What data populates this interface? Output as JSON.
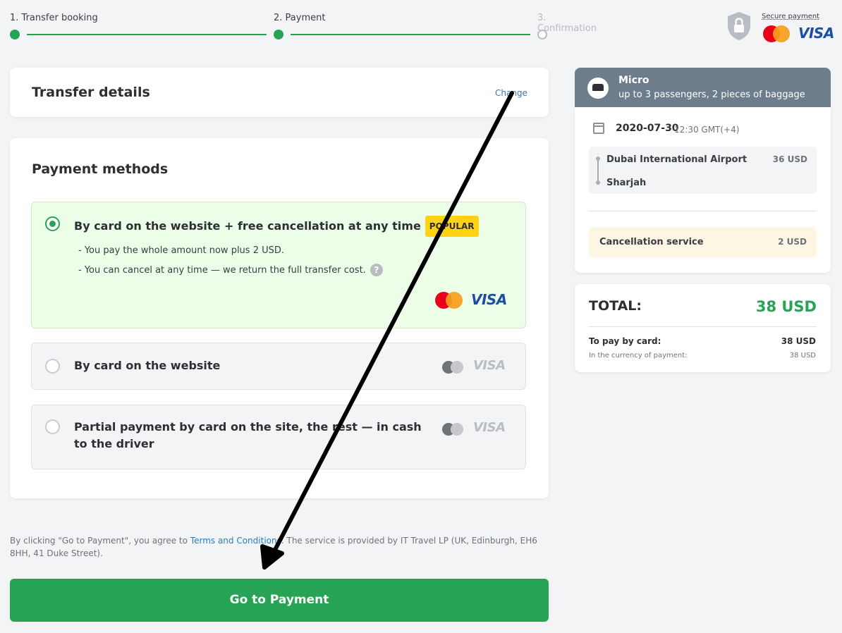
{
  "stepper": {
    "steps": [
      {
        "label": "1. Transfer booking",
        "state": "done"
      },
      {
        "label": "2. Payment",
        "state": "current"
      },
      {
        "label": "3. Confirmation",
        "state": "pending"
      }
    ]
  },
  "secure": {
    "label": "Secure payment",
    "visa": "VISA"
  },
  "transfer_details": {
    "title": "Transfer details",
    "change_link": "Change"
  },
  "payment": {
    "title": "Payment methods",
    "options": [
      {
        "title": "By card on the website + free cancellation at any time",
        "badge": "POPULAR",
        "notes": [
          "- You pay the whole amount now plus 2 USD.",
          "- You can cancel at any time — we return the full transfer cost."
        ],
        "help": "?",
        "visa": "VISA",
        "selected": true
      },
      {
        "title": "By card on the website",
        "visa": "VISA",
        "selected": false
      },
      {
        "title": "Partial payment by card on the site, the rest — in cash to the driver",
        "visa": "VISA",
        "selected": false
      }
    ]
  },
  "legal": {
    "prefix": "By clicking \"Go to Payment\", you agree to ",
    "link": "Terms and Conditions",
    "suffix": ". The service is provided by IT Travel LP (UK, Edinburgh, EH6 8HH, 41 Duke Street)."
  },
  "cta": {
    "label": "Go to Payment"
  },
  "summary": {
    "vehicle": "Micro",
    "capacity": "up to 3 passengers, 2 pieces of baggage",
    "date": "2020-07-30",
    "time": "12:30 GMT(+4)",
    "route": {
      "from": "Dubai International Airport",
      "to": "Sharjah",
      "price": "36 USD"
    },
    "cancellation": {
      "label": "Cancellation service",
      "price": "2 USD"
    }
  },
  "total": {
    "label": "TOTAL:",
    "value": "38 USD",
    "to_pay_label": "To pay by card:",
    "to_pay_value": "38 USD",
    "currency_label": "In the currency of payment:",
    "currency_value": "38 USD"
  },
  "colors": {
    "accent": "#27a356",
    "badge": "#ffd312",
    "header": "#6e7d8c",
    "link": "#2c7bbf"
  }
}
